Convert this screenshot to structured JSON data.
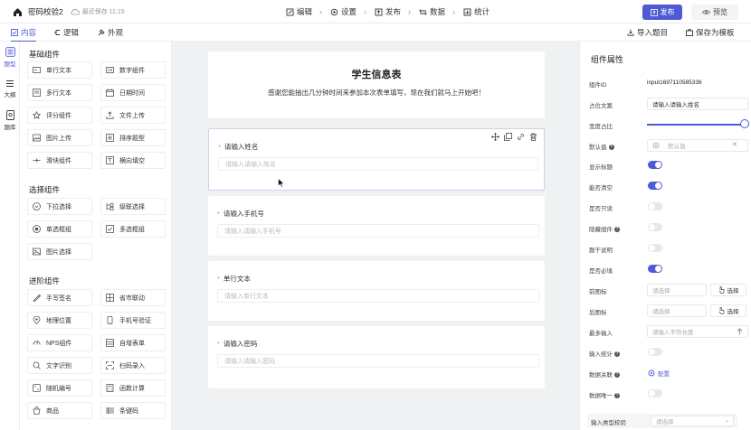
{
  "topbar": {
    "title": "密码校验2",
    "saved": "最近保存 11:15",
    "nav": [
      {
        "label": "编辑",
        "icon": "edit-icon"
      },
      {
        "label": "设置",
        "icon": "gear-icon"
      },
      {
        "label": "发布",
        "icon": "publish-icon"
      },
      {
        "label": "数据",
        "icon": "data-icon"
      },
      {
        "label": "统计",
        "icon": "stats-icon"
      }
    ],
    "publish_label": "发布",
    "preview_label": "预览"
  },
  "subbar": {
    "tabs": [
      {
        "label": "内容",
        "icon": "content-icon"
      },
      {
        "label": "逻辑",
        "icon": "logic-icon"
      },
      {
        "label": "外观",
        "icon": "appearance-icon"
      }
    ],
    "import_label": "导入题目",
    "save_template_label": "保存为模板"
  },
  "rail": {
    "items": [
      {
        "label": "题型",
        "icon": "question-types-icon"
      },
      {
        "label": "大纲",
        "icon": "outline-icon"
      },
      {
        "label": "题库",
        "icon": "question-bank-icon"
      }
    ]
  },
  "library": {
    "basic": {
      "title": "基础组件",
      "items": [
        "单行文本",
        "数字组件",
        "多行文本",
        "日期时间",
        "评分组件",
        "文件上传",
        "图片上传",
        "排序题型",
        "滑块组件",
        "横向填空"
      ]
    },
    "choice": {
      "title": "选择组件",
      "items": [
        "下拉选择",
        "级联选择",
        "单选框组",
        "多选框组",
        "图片选择"
      ]
    },
    "advanced": {
      "title": "进阶组件",
      "items": [
        "手写签名",
        "省市联动",
        "地理位置",
        "手机号验证",
        "NPS组件",
        "自增表单",
        "文字识别",
        "扫码录入",
        "随机编号",
        "函数计算",
        "商品",
        "条键码"
      ]
    }
  },
  "form": {
    "title": "学生信息表",
    "description": "感谢您能抽出几分钟时间来参加本次表单填写，现在我们就马上开始吧！",
    "questions": [
      {
        "label": "请输入姓名",
        "placeholder": "请输入请输入姓名"
      },
      {
        "label": "请输入手机号",
        "placeholder": "请输入请输入手机号"
      },
      {
        "label": "单行文本",
        "placeholder": "请输入单行文本"
      },
      {
        "label": "请输入密码",
        "placeholder": "请输入请输入密码"
      }
    ]
  },
  "props": {
    "title": "组件属性",
    "component_id_label": "组件ID",
    "component_id": "input1697110585336",
    "placeholder_label": "占位文案",
    "placeholder_value": "请输入请输入姓名",
    "width_label": "宽度占比",
    "width_fraction": 1.0,
    "default_label": "默认值",
    "default_placeholder": "默认值",
    "toggles": [
      {
        "label": "显示标题",
        "on": true,
        "help": false
      },
      {
        "label": "能否清空",
        "on": true,
        "help": false
      },
      {
        "label": "是否只读",
        "on": false,
        "help": false
      },
      {
        "label": "隐藏组件",
        "on": false,
        "help": true
      },
      {
        "label": "题干说明",
        "on": false,
        "help": false
      },
      {
        "label": "是否必填",
        "on": true,
        "help": false
      }
    ],
    "prefix_label": "前图标",
    "suffix_label": "后图标",
    "select_placeholder": "请选择",
    "select_button": "选择",
    "maxlen_label": "最多输入",
    "maxlen_placeholder": "请输入字符长度",
    "stats_label": "输入统计",
    "relation_label": "数据关联",
    "relation_action": "配置",
    "unique_label": "数据唯一",
    "type_check_label": "输入类型校验",
    "type_check_placeholder": "请选择"
  },
  "colors": {
    "accent": "#4f5bd5"
  }
}
